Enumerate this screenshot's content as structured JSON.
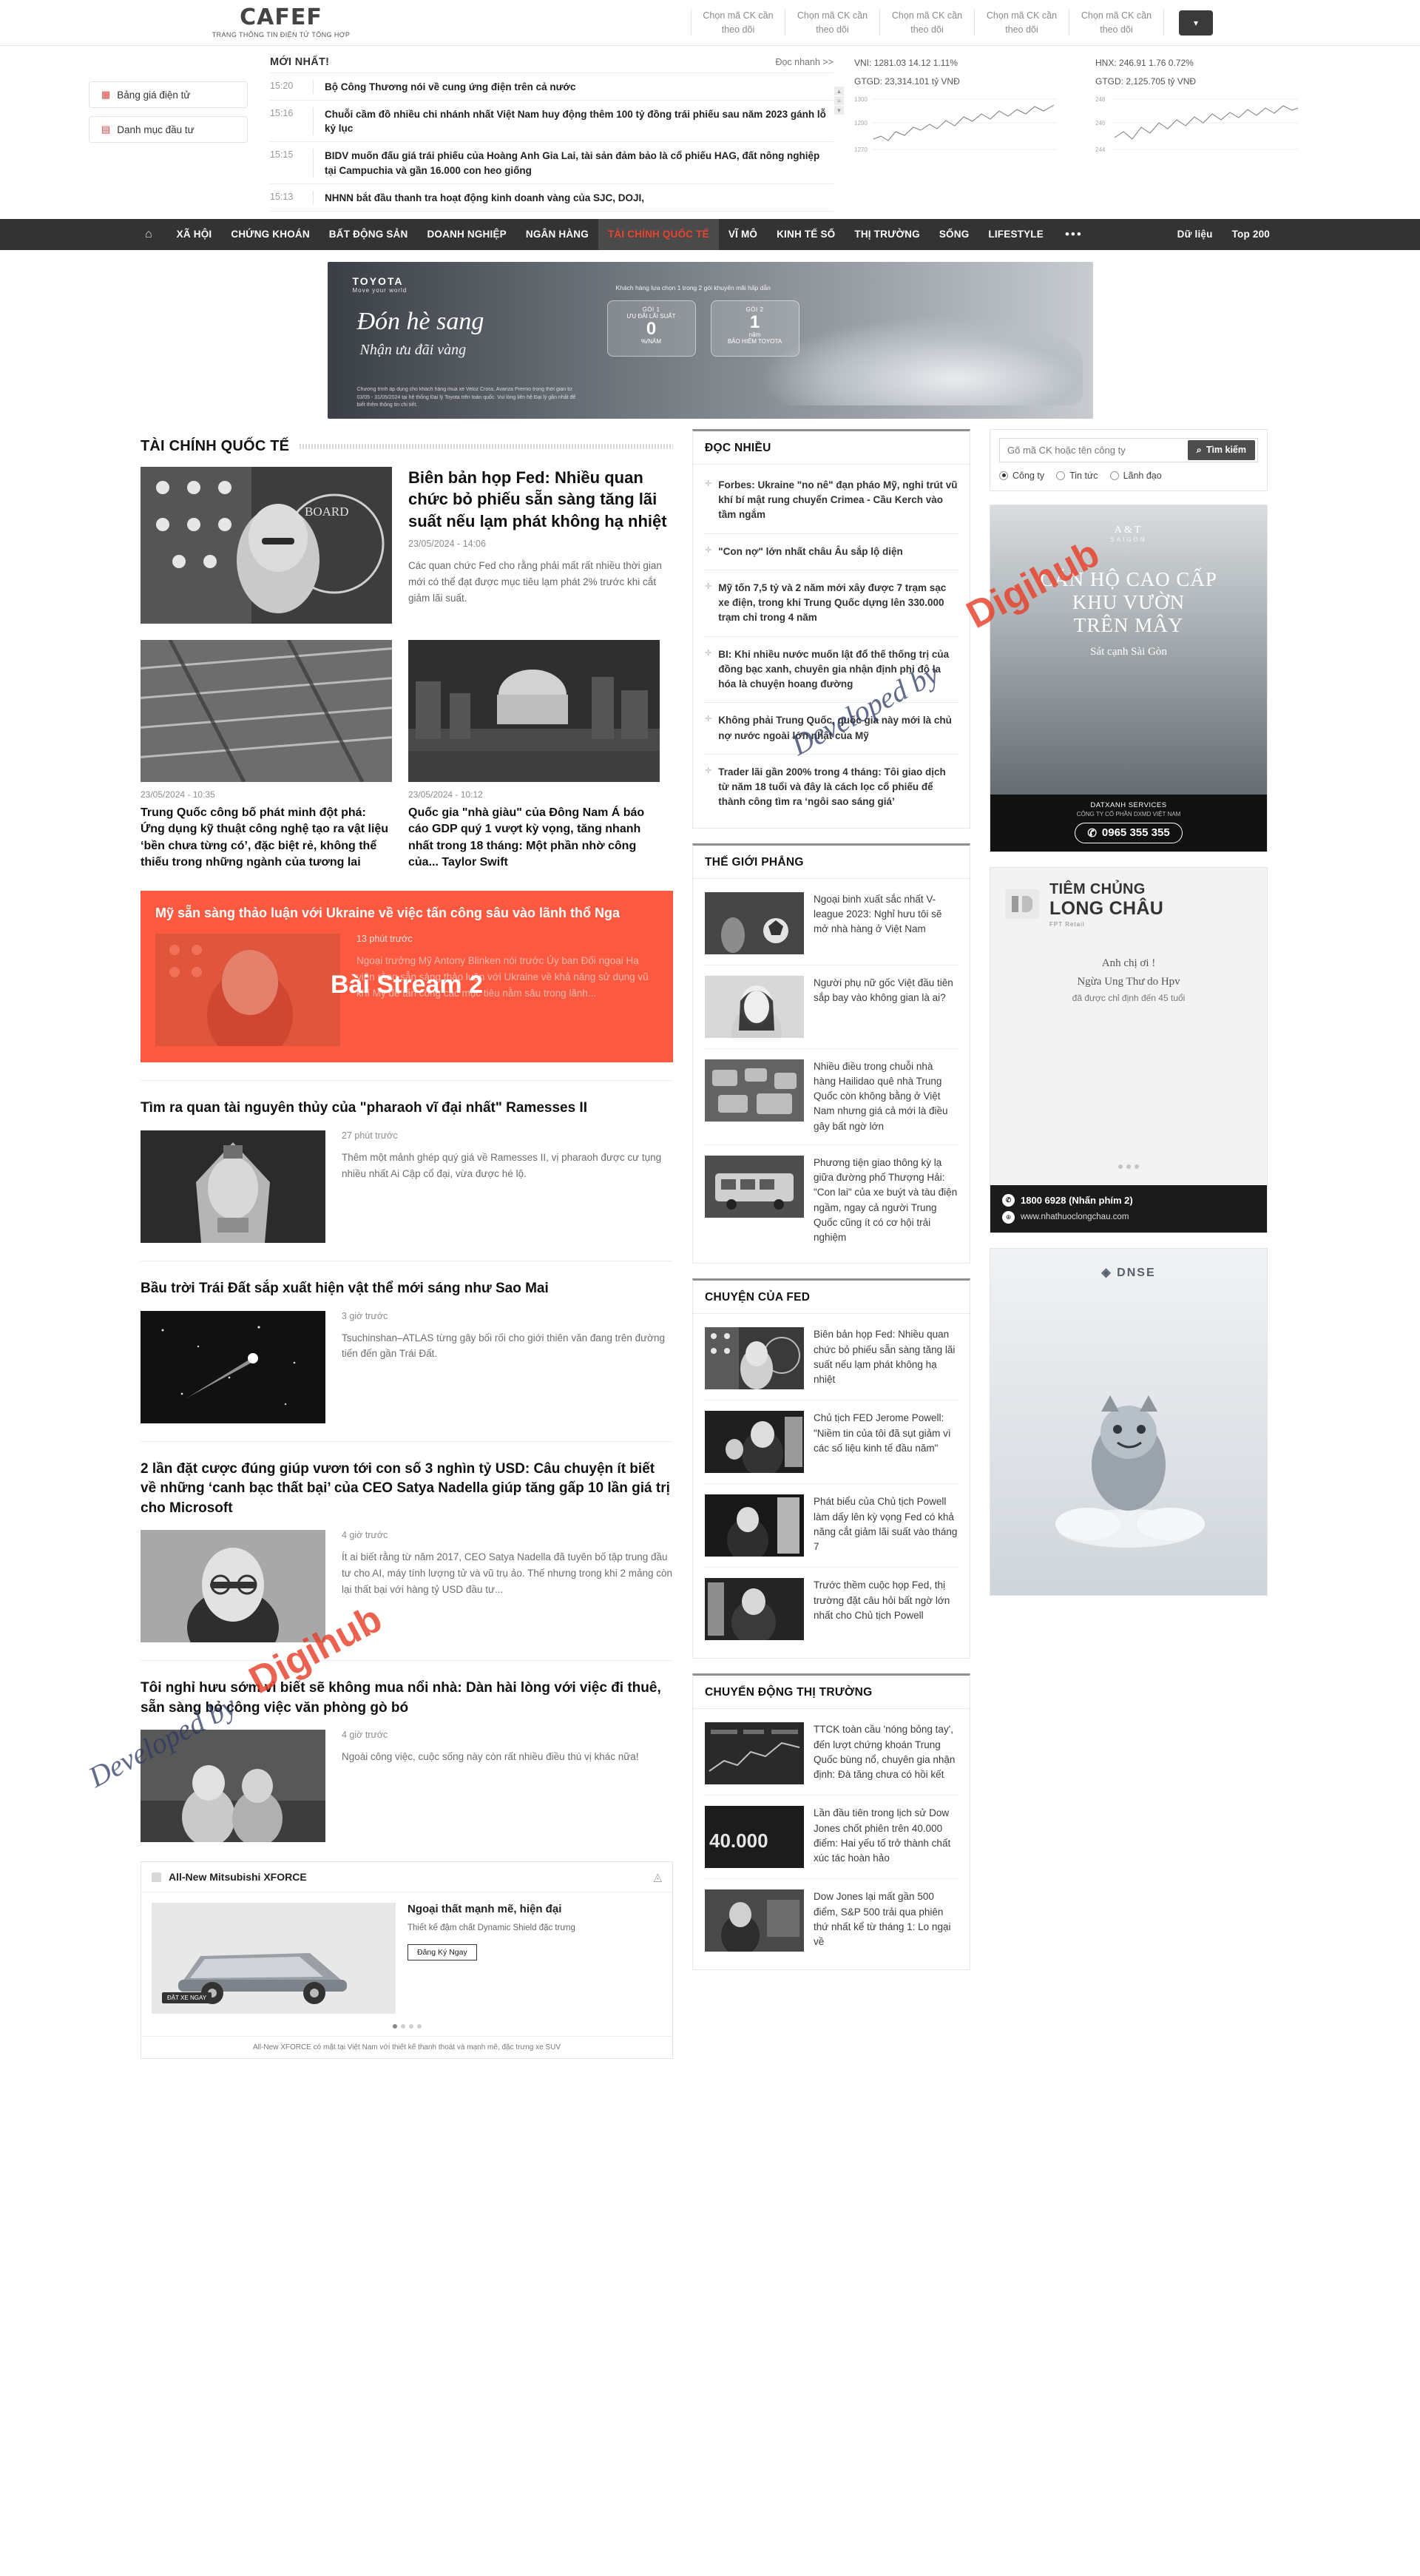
{
  "site": {
    "logo_text": "CAFEF",
    "logo_tagline": "TRANG THÔNG TIN ĐIỆN TỬ TỔNG HỢP",
    "stock_picker_label": "Chọn mã CK cần theo dõi",
    "caret_icon": "chevron-down-icon"
  },
  "header": {
    "buttons": [
      {
        "label": "Bảng giá điện tử",
        "icon": "chart-icon"
      },
      {
        "label": "Danh mục đầu tư",
        "icon": "briefcase-icon"
      }
    ],
    "latest_label": "MỚI NHẤT!",
    "quick_read_label": "Đọc nhanh >>",
    "latest_news": [
      {
        "time": "15:20",
        "title": "Bộ Công Thương nói về cung ứng điện trên cả nước"
      },
      {
        "time": "15:16",
        "title": "Chuỗi cầm đồ nhiều chi nhánh nhất Việt Nam huy động thêm 100 tỷ đồng trái phiếu sau năm 2023 gánh lỗ kỷ lục"
      },
      {
        "time": "15:15",
        "title": "BIDV muốn đấu giá trái phiếu của Hoàng Anh Gia Lai, tài sản đảm bảo là cổ phiếu HAG, đất nông nghiệp tại Campuchia và gần 16.000 con heo giống"
      },
      {
        "time": "15:13",
        "title": "NHNN bắt đầu thanh tra hoạt động kinh doanh vàng của SJC, DOJI,"
      }
    ],
    "indices": [
      {
        "code": "VNI",
        "value": "1281.03",
        "change": "14.12",
        "percent": "1.11%",
        "turnover_label": "GTGD:",
        "turnover": "23,314.101 tỷ VNĐ",
        "axis_top": "1300",
        "axis_mid": "1290",
        "axis_bottom": "1270"
      },
      {
        "code": "HNX",
        "value": "246.91",
        "change": "1.76",
        "percent": "0.72%",
        "turnover_label": "GTGD:",
        "turnover": "2,125.705 tỷ VNĐ",
        "axis_top": "248",
        "axis_mid": "246",
        "axis_bottom": "244"
      }
    ]
  },
  "nav": {
    "home_icon": "home-icon",
    "items": [
      {
        "label": "XÃ HỘI",
        "active": false
      },
      {
        "label": "CHỨNG KHOÁN",
        "active": false
      },
      {
        "label": "BẤT ĐỘNG SẢN",
        "active": false
      },
      {
        "label": "DOANH NGHIỆP",
        "active": false
      },
      {
        "label": "NGÂN HÀNG",
        "active": false
      },
      {
        "label": "TÀI CHÍNH QUỐC TẾ",
        "active": true
      },
      {
        "label": "VĨ MÔ",
        "active": false
      },
      {
        "label": "KINH TẾ SỐ",
        "active": false
      },
      {
        "label": "THỊ TRƯỜNG",
        "active": false
      },
      {
        "label": "SỐNG",
        "active": false
      },
      {
        "label": "LIFESTYLE",
        "active": false
      }
    ],
    "more_icon": "ellipsis-icon",
    "right_items": [
      {
        "label": "Dữ liệu"
      },
      {
        "label": "Top 200"
      }
    ]
  },
  "banner": {
    "brand": "TOYOTA",
    "brand_sub": "Move your world",
    "headline": "Đón hè sang",
    "subline": "Nhận ưu đãi vàng",
    "note": "Khách hàng lựa chọn 1 trong 2 gói khuyến mãi hấp dẫn",
    "offer1_label": "GÓI 1",
    "offer1_line": "ƯU ĐÃI LÃI SUẤT",
    "offer1_value": "0",
    "offer1_unit": "%/NĂM",
    "offer2_label": "GÓI 2",
    "offer2_value": "1",
    "offer2_line": "năm",
    "offer2_unit": "BẢO HIỂM TOYOTA",
    "footnote": "Chương trình áp dụng cho khách hàng mua xe Veloz Cross, Avanza Premio trong thời gian từ 03/05 - 31/05/2024 tại hệ thống Đại lý Toyota trên toàn quốc. Vui lòng liên hệ Đại lý gần nhất để biết thêm thông tin chi tiết."
  },
  "search": {
    "placeholder": "Gõ mã CK hoặc tên công ty",
    "button_label": "Tìm kiếm",
    "button_icon": "search-icon",
    "options": [
      {
        "label": "Công ty",
        "selected": true
      },
      {
        "label": "Tin tức",
        "selected": false
      },
      {
        "label": "Lãnh đạo",
        "selected": false
      }
    ]
  },
  "main": {
    "section_title": "TÀI CHÍNH QUỐC TẾ",
    "lead": {
      "title": "Biên bản họp Fed: Nhiều quan chức bỏ phiếu sẵn sàng tăng lãi suất nếu lạm phát không hạ nhiệt",
      "date": "23/05/2024 - 14:06",
      "sapo": "Các quan chức Fed cho rằng phải mất rất nhiều thời gian mới có thể đạt được mục tiêu lạm phát 2% trước khi cắt giảm lãi suất."
    },
    "two_up": [
      {
        "date": "23/05/2024 - 10:35",
        "title": "Trung Quốc công bố phát minh đột phá: Ứng dụng kỹ thuật công nghệ tạo ra vật liệu ‘bền chưa từng có’, đặc biệt rẻ, không thể thiếu trong những ngành của tương lai"
      },
      {
        "date": "23/05/2024 - 10:12",
        "title": "Quốc gia \"nhà giàu\" của Đông Nam Á báo cáo GDP quý 1 vượt kỳ vọng, tăng nhanh nhất trong 18 tháng: Một phần nhờ công của... Taylor Swift"
      }
    ],
    "stream": {
      "title": "Mỹ sẵn sàng thảo luận với Ukraine về việc tấn công sâu vào lãnh thổ Nga",
      "meta": "13 phút trước",
      "sapo": "Ngoại trưởng Mỹ Antony Blinken nói trước Ủy ban Đối ngoại Hạ viện rằng sẵn sàng thảo luận với Ukraine về khả năng sử dụng vũ khí Mỹ để tấn công các mục tiêu nằm sâu trong lãnh...",
      "overlay_label": "Bài Stream 2"
    },
    "articles": [
      {
        "title": "Tìm ra quan tài nguyên thủy của \"pharaoh vĩ đại nhất\" Ramesses II",
        "meta": "27 phút trước",
        "sapo": "Thêm một mảnh ghép quý giá về Ramesses II, vị pharaoh được cư tụng nhiều nhất Ai Cập cổ đại, vừa được hé lộ."
      },
      {
        "title": "Bầu trời Trái Đất sắp xuất hiện vật thể mới sáng như Sao Mai",
        "meta": "3 giờ trước",
        "sapo": "Tsuchinshan–ATLAS từng gây bối rối cho giới thiên văn đang trên đường tiến đến gần Trái Đất."
      },
      {
        "title": "2 lần đặt cược đúng giúp vươn tới con số 3 nghìn tỷ USD: Câu chuyện ít biết về những ‘canh bạc thất bại’ của CEO Satya Nadella giúp tăng gấp 10 lần giá trị cho Microsoft",
        "meta": "4 giờ trước",
        "sapo": "Ít ai biết rằng từ năm 2017, CEO Satya Nadella đã tuyên bố tập trung đầu tư cho AI, máy tính lượng tử và vũ trụ ảo. Thế nhưng trong khi 2 mảng còn lại thất bại với hàng tỷ USD đầu tư..."
      },
      {
        "title": "Tôi nghỉ hưu sớm vì biết sẽ không mua nổi nhà: Dàn hài lòng với việc đi thuê, sẵn sàng bỏ công việc văn phòng gò bó",
        "meta": "4 giờ trước",
        "sapo": "Ngoài công việc, cuộc sống này còn rất nhiều điều thú vị khác nữa!"
      }
    ],
    "car_ad": {
      "title": "All-New Mitsubishi XFORCE",
      "brand_icon": "mitsubishi-icon",
      "close_icon": "close-icon",
      "heading": "Ngoại thất mạnh mẽ, hiện đại",
      "paragraph": "Thiết kế đậm chất Dynamic Shield đặc trưng",
      "cta": "Đăng Ký Ngay",
      "image_tag": "ĐẶT XE NGAY",
      "footnote": "All-New XFORCE có mặt tại Việt Nam với thiết kế thanh thoát và mạnh mẽ, đặc trưng xe SUV"
    }
  },
  "mid": {
    "doc_nhieu": {
      "title": "ĐỌC NHIỀU",
      "items": [
        "Forbes: Ukraine \"no nê\" đạn pháo Mỹ, nghi trút vũ khí bí mật rung chuyển Crimea - Cầu Kerch vào tầm ngắm",
        "\"Con nợ\" lớn nhất châu Âu sắp lộ diện",
        "Mỹ tốn 7,5 tỷ và 2 năm mới xây được 7 trạm sạc xe điện, trong khi Trung Quốc dựng lên 330.000 trạm chỉ trong 4 năm",
        "BI: Khi nhiều nước muốn lật đổ thế thống trị của đồng bạc xanh, chuyên gia nhận định phi đô la hóa là chuyện hoang đường",
        "Không phải Trung Quốc, quốc gia này mới là chủ nợ nước ngoài lớn nhất của Mỹ",
        "Trader lãi gần 200% trong 4 tháng: Tôi giao dịch từ năm 18 tuổi và đây là cách lọc cổ phiếu để thành công tìm ra ‘ngôi sao sáng giá’"
      ]
    },
    "the_gioi_phang": {
      "title": "THẾ GIỚI PHẲNG",
      "items": [
        "Ngoại binh xuất sắc nhất V-league 2023: Nghỉ hưu tôi sẽ mở nhà hàng ở Việt Nam",
        "Người phụ nữ gốc Việt đầu tiên sắp bay vào không gian là ai?",
        "Nhiều điều trong chuỗi nhà hàng Hailidao quê nhà Trung Quốc còn không bằng ở Việt Nam nhưng giá cả mới là điều gây bất ngờ lớn",
        "Phương tiện giao thông kỳ lạ giữa đường phố Thượng Hải: \"Con lai\" của xe buýt và tàu điện ngầm, ngay cả người Trung Quốc cũng ít có cơ hội trải nghiệm"
      ]
    },
    "chuyen_cua_fed": {
      "title": "CHUYỆN CỦA FED",
      "items": [
        "Biên bản họp Fed: Nhiều quan chức bỏ phiếu sẵn sàng tăng lãi suất nếu lạm phát không hạ nhiệt",
        "Chủ tịch FED Jerome Powell: \"Niềm tin của tôi đã sụt giảm vì các số liệu kinh tế đầu năm\"",
        "Phát biểu của Chủ tịch Powell làm dấy lên kỳ vọng Fed có khả năng cắt giảm lãi suất vào tháng 7",
        "Trước thềm cuộc họp Fed, thị trường đặt câu hỏi bất ngờ lớn nhất cho Chủ tịch Powell"
      ]
    },
    "chuyen_dong_thi_truong": {
      "title": "CHUYỂN ĐỘNG THỊ TRƯỜNG",
      "items": [
        "TTCK toàn cầu 'nóng bỏng tay', đến lượt chứng khoán Trung Quốc bùng nổ, chuyên gia nhận định: Đà tăng chưa có hồi kết",
        "Lần đầu tiên trong lịch sử Dow Jones chốt phiên trên 40.000 điểm: Hai yếu tố trở thành chất xúc tác hoàn hảo",
        "Dow Jones lại mất gần 500 điểm, S&P 500 trải qua phiên thứ nhất kể từ tháng 1: Lo ngại về"
      ]
    }
  },
  "right": {
    "real_estate_ad": {
      "brand": "A&T",
      "brand_sub": "SAIGON",
      "h1": "CĂN HỘ CAO CẤP",
      "h2": "KHU VƯỜN",
      "h3": "TRÊN MÂY",
      "tagline": "Sát cạnh Sài Gòn",
      "company": "DATXANH SERVICES",
      "company_sub": "CÔNG TY CỔ PHẦN DXMD VIỆT NAM",
      "phone": "0965 355 355",
      "phone_icon": "phone-icon"
    },
    "pharma_ad": {
      "brand_line1": "TIÊM CHỦNG",
      "brand_line2": "LONG CHÂU",
      "brand_sub": "FPT Retail",
      "logo_icon": "pharmacy-icon",
      "mid_line1": "Anh chị ơi !",
      "mid_line2": "Ngừa Ung Thư do Hpv",
      "mid_line3": "đã được chỉ định đến 45 tuổi",
      "hotline": "1800 6928 (Nhấn phím 2)",
      "website": "www.nhathuoclongchau.com",
      "hotline_icon": "phone-icon",
      "globe_icon": "globe-icon"
    },
    "dnse_ad": {
      "brand": "DNSE",
      "brand_icon": "diamond-icon"
    }
  },
  "watermarks": [
    {
      "text": "Developed by",
      "type": "dev"
    },
    {
      "text": "Digihub",
      "type": "hub"
    }
  ],
  "colors": {
    "accent_red": "#e8442e",
    "stream_bg": "#fb5a40",
    "nav_bg": "#333333",
    "watermark_blue": "#2b3a63",
    "watermark_red": "#e8402a"
  }
}
